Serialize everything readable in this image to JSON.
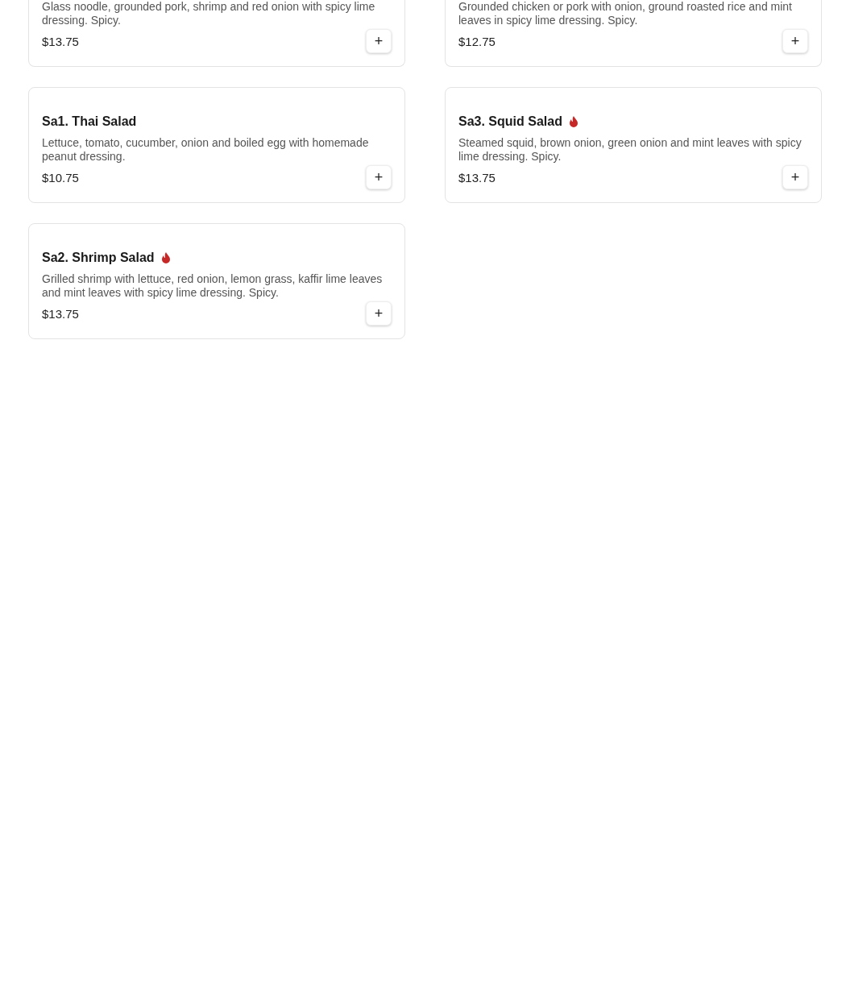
{
  "items": [
    {
      "description": "Glass noodle, grounded pork, shrimp and red onion with spicy lime dressing. Spicy.",
      "price": "$13.75",
      "add_button": "+"
    },
    {
      "description": "Grounded chicken or pork with onion, ground roasted rice and mint leaves in spicy lime dressing. Spicy.",
      "price": "$12.75",
      "add_button": "+"
    },
    {
      "title": "Sa1. Thai Salad",
      "spicy": false,
      "description": "Lettuce, tomato, cucumber, onion and boiled egg with homemade peanut dressing.",
      "price": "$10.75",
      "add_button": "+"
    },
    {
      "title": "Sa3. Squid Salad",
      "spicy": true,
      "description": "Steamed squid, brown onion, green onion and mint leaves with spicy lime dressing. Spicy.",
      "price": "$13.75",
      "add_button": "+"
    },
    {
      "title": "Sa2. Shrimp Salad",
      "spicy": true,
      "description": "Grilled shrimp with lettuce, red onion, lemon grass, kaffir lime leaves and mint leaves with spicy lime dressing. Spicy.",
      "price": "$13.75",
      "add_button": "+"
    }
  ]
}
